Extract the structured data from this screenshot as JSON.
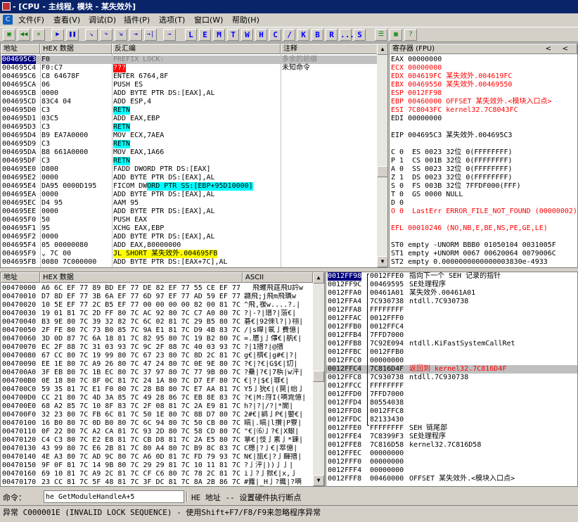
{
  "window": {
    "title": "- [CPU - 主线程, 模块 - 某失效外]"
  },
  "menu": [
    {
      "label": "文件(F)",
      "name": "menu-file"
    },
    {
      "label": "查看(V)",
      "name": "menu-view"
    },
    {
      "label": "调试(D)",
      "name": "menu-debug"
    },
    {
      "label": "插件(P)",
      "name": "menu-plugins"
    },
    {
      "label": "选项(T)",
      "name": "menu-options"
    },
    {
      "label": "窗口(W)",
      "name": "menu-window"
    },
    {
      "label": "帮助(H)",
      "name": "menu-help"
    }
  ],
  "toolbar": {
    "buttons": [
      {
        "icon": "open-icon",
        "glyph": "▣"
      },
      {
        "icon": "rewind-icon",
        "glyph": "◀◀"
      },
      {
        "icon": "close-icon",
        "glyph": "✕"
      },
      {
        "icon": "run-icon",
        "glyph": "▶"
      },
      {
        "icon": "pause-icon",
        "glyph": "❚❚"
      },
      {
        "icon": "step-into-icon",
        "glyph": "↘"
      },
      {
        "icon": "step-over-icon",
        "glyph": "↷"
      },
      {
        "icon": "trace-into-icon",
        "glyph": "⇲"
      },
      {
        "icon": "trace-over-icon",
        "glyph": "⇥"
      },
      {
        "icon": "execute-till-return-icon",
        "glyph": "→|"
      },
      {
        "icon": "goto-icon",
        "glyph": "→"
      }
    ],
    "letters": [
      "L",
      "E",
      "M",
      "T",
      "W",
      "H",
      "C",
      "/",
      "K",
      "B",
      "R",
      "...",
      "S"
    ],
    "extra": [
      {
        "icon": "list-icon",
        "glyph": "☰"
      },
      {
        "icon": "grid-icon",
        "glyph": "▦"
      },
      {
        "icon": "help-icon",
        "glyph": "?"
      }
    ]
  },
  "disasm": {
    "headers": [
      "地址",
      "HEX 数据",
      "反汇编",
      "注释"
    ],
    "rows": [
      {
        "addr": "004695C3",
        "hex": "F0",
        "asm": "PREFIX LOCK:",
        "cmt": "多余的前缀",
        "state": "selected"
      },
      {
        "addr": "004695C4",
        "hex": "F0:C7",
        "asm": "???",
        "cmt": "未知命令",
        "asm_style": "red"
      },
      {
        "addr": "004695C6",
        "hex": "C8 64678F",
        "asm": "ENTER 6764,8F",
        "cmt": ""
      },
      {
        "addr": "004695CA",
        "hex": "06",
        "asm": "PUSH ES",
        "cmt": ""
      },
      {
        "addr": "004695CB",
        "hex": "0000",
        "asm": "ADD BYTE PTR DS:[EAX],AL",
        "cmt": ""
      },
      {
        "addr": "004695CD",
        "hex": "83C4 04",
        "asm": "ADD ESP,4",
        "cmt": ""
      },
      {
        "addr": "004695D0",
        "hex": "C3",
        "asm": "RETN",
        "cmt": "",
        "asm_style": "cyan"
      },
      {
        "addr": "004695D1",
        "hex": "03C5",
        "asm": "ADD EAX,EBP",
        "cmt": ""
      },
      {
        "addr": "004695D3",
        "hex": "C3",
        "asm": "RETN",
        "cmt": "",
        "asm_style": "cyan"
      },
      {
        "addr": "004695D4",
        "hex": "B9 EA7A0000",
        "asm": "MOV ECX,7AEA",
        "cmt": ""
      },
      {
        "addr": "004695D9",
        "hex": "C3",
        "asm": "RETN",
        "cmt": "",
        "asm_style": "cyan"
      },
      {
        "addr": "004695DA",
        "hex": "B8 661A0000",
        "asm": "MOV EAX,1A66",
        "cmt": ""
      },
      {
        "addr": "004695DF",
        "hex": "C3",
        "asm": "RETN",
        "cmt": "",
        "asm_style": "cyan"
      },
      {
        "addr": "004695E0",
        "hex": "D800",
        "asm": "FADD DWORD PTR DS:[EAX]",
        "cmt": ""
      },
      {
        "addr": "004695E2",
        "hex": "0000",
        "asm": "ADD BYTE PTR DS:[EAX],AL",
        "cmt": ""
      },
      {
        "addr": "004695E4",
        "hex": "DA95 0000D195",
        "asm": "FICOM DWORD PTR SS:[EBP+95D10000]",
        "cmt": "",
        "asm_style": "cyanpart"
      },
      {
        "addr": "004695EA",
        "hex": "0000",
        "asm": "ADD BYTE PTR DS:[EAX],AL",
        "cmt": ""
      },
      {
        "addr": "004695EC",
        "hex": "D4 95",
        "asm": "AAM 95",
        "cmt": ""
      },
      {
        "addr": "004695EE",
        "hex": "0000",
        "asm": "ADD BYTE PTR DS:[EAX],AL",
        "cmt": ""
      },
      {
        "addr": "004695F0",
        "hex": "50",
        "asm": "PUSH EAX",
        "cmt": ""
      },
      {
        "addr": "004695F1",
        "hex": "95",
        "asm": "XCHG EAX,EBP",
        "cmt": ""
      },
      {
        "addr": "004695F2",
        "hex": "0000",
        "asm": "ADD BYTE PTR DS:[EAX],AL",
        "cmt": ""
      },
      {
        "addr": "004695F4",
        "hex": "05 00000080",
        "asm": "ADD EAX,80000000",
        "cmt": ""
      },
      {
        "addr": "004695F9",
        "hex": "⌄ 7C 00",
        "asm": "JL SHORT 某失效外.004695FB",
        "cmt": "",
        "asm_style": "yellow"
      },
      {
        "addr": "004695FB",
        "hex": "0080 7C000000",
        "asm": "ADD BYTE PTR DS:[EAX+7C],AL",
        "cmt": ""
      }
    ]
  },
  "registers": {
    "header": "寄存器 (FPU)",
    "nav": [
      "<",
      "<"
    ],
    "lines": [
      {
        "t": "EAX 00000000"
      },
      {
        "t": "ECX 00000000",
        "r": true
      },
      {
        "t": "EDX 004619FC 某失效外.004619FC",
        "r": true
      },
      {
        "t": "EBX 00469550 某失效外.00469550",
        "r": true
      },
      {
        "t": "ESP 0012FF98",
        "r": true
      },
      {
        "t": "EBP 00460000 OFFSET 某失效外.<模块入口点>",
        "r": true
      },
      {
        "t": "ESI 7C8043FC kernel32.7C8043FC",
        "r": true
      },
      {
        "t": "EDI 00000000"
      },
      {
        "t": ""
      },
      {
        "t": "EIP 004695C3 某失效外.004695C3"
      },
      {
        "t": ""
      },
      {
        "t": "C 0  ES 0023 32位 0(FFFFFFFF)"
      },
      {
        "t": "P 1  CS 001B 32位 0(FFFFFFFF)"
      },
      {
        "t": "A 0  SS 0023 32位 0(FFFFFFFF)"
      },
      {
        "t": "Z 1  DS 0023 32位 0(FFFFFFFF)"
      },
      {
        "t": "S 0  FS 003B 32位 7FFDF000(FFF)"
      },
      {
        "t": "T 0  GS 0000 NULL"
      },
      {
        "t": "D 0"
      },
      {
        "t": "O 0  LastErr ERROR_FILE_NOT_FOUND (00000002)",
        "r": true
      },
      {
        "t": ""
      },
      {
        "t": "EFL 00010246 (NO,NB,E,BE,NS,PE,GE,LE)"
      },
      {
        "t": ""
      },
      {
        "t": "ST0 empty -UNORM BBB0 01050104 0031005F"
      },
      {
        "t": "ST1 empty +UNORM 0067 00620064 0079006C"
      },
      {
        "t": "ST2 empty 0.0000000000000003830e-4933"
      },
      {
        "t": "ST3 empty 0.0"
      },
      {
        "t": "ST4 empty 0.0"
      }
    ]
  },
  "dump": {
    "headers": [
      "地址",
      "HEX 数据",
      "ASCII"
    ],
    "rows": [
      {
        "a": "00470000",
        "h": "A6 6C EF 77 89 BD EF 77 DE 82 EF 77 55 CE EF 77",
        "s": "  飛蠼飛莛飛U訡w"
      },
      {
        "a": "00470010",
        "h": "D7 8D EF 77 3B 6A EF 77 6D 97 EF 77 AD 59 EF 77",
        "s": "讔飛;j飛m飛璝w"
      },
      {
        "a": "00470020",
        "h": "10 5E EF 77 2C B5 EF 77 00 00 00 00 82 00 81 7C",
        "s": "^飛,禐w....?.|"
      },
      {
        "a": "00470030",
        "h": "19 01 81 7C 2D FF 80 7C AC 92 80 7C C7 A0 80 7C",
        "s": "?|-?|瑨?|菭€|"
      },
      {
        "a": "00470040",
        "h": "B3 9E 80 7C 39 32 82 7C 6C 02 81 7C 29 B5 80 7C",
        "s": "碁€|92倈l?|)祤|"
      },
      {
        "a": "00470050",
        "h": "2F FE 80 7C 73 B0 85 7C 9A E1 81 7C D9 4B 83 7C",
        "s": "/|s皡|氠亅費億|"
      },
      {
        "a": "00470060",
        "h": "3D 0D 87 7C 6A 18 81 7C 82 95 80 7C 19 B2 80 7C",
        "s": "=.噟j亅倳€|舧€|"
      },
      {
        "a": "00470070",
        "h": "EC 2F 88 7C 31 03 93 7C 9C 2F 88 7C 40 03 93 7C",
        "s": "?|1搢?|@搢"
      },
      {
        "a": "00470080",
        "h": "67 CC 80 7C 19 99 80 7C 67 23 80 7C 8D 2C 81 7C",
        "s": "g€|櫅€|g#€|?|"
      },
      {
        "a": "00470090",
        "h": "EE 1E 80 7C A9 26 80 7C 47 24 80 7C 0E 9E 80 7C",
        "s": "?€|?€|G$€|灱|"
      },
      {
        "a": "004700A0",
        "h": "3F EB 80 7C 1B EC 80 7C 37 97 80 7C 77 9B 80 7C",
        "s": "?雧|?€|7梹|w泙|"
      },
      {
        "a": "004700B0",
        "h": "0E 18 80 7C 8F 0C 81 7C 24 1A 80 7C D7 EF 80 7C",
        "s": "€|?|$€|罪€|"
      },
      {
        "a": "004700C0",
        "h": "59 35 81 7C E1 F0 80 7C 28 B8 80 7C E7 AA 81 7C",
        "s": "Y5亅狁€|(笢|绐亅"
      },
      {
        "a": "004700D0",
        "h": "CC 21 80 7C 4D 3A 85 7C 49 28 86 7C EB 8E 83 7C",
        "s": "?€|M:厊I(唡雿億|"
      },
      {
        "a": "004700E0",
        "h": "68 A2 85 7C 10 8F 83 7C 2F 08 81 7C 2A E9 81 7C",
        "s": "h?|?|/?|*閬|"
      },
      {
        "a": "004700F0",
        "h": "32 23 80 7C FB 6C 81 7C 50 1E 80 7C 8B D7 80 7C",
        "s": "2#€|鹟亅P€|嬜€|"
      },
      {
        "a": "00470100",
        "h": "16 B0 80 7C 0D B0 80 7C 6C 94 80 7C 50 CB 80 7C",
        "s": "皜|.皜|l攢|P藔|"
      },
      {
        "a": "00470110",
        "h": "0F 22 80 7C A2 CA 81 7C 93 2D 80 7C 58 CD 80 7C",
        "s": "\"€|⑹亅?€|X蛝|"
      },
      {
        "a": "00470120",
        "h": "C4 C3 80 7C E2 E8 81 7C CB D8 81 7C 2A E5 80 7C",
        "s": "拿€|忮亅素亅*鍊|"
      },
      {
        "a": "00470130",
        "h": "43 99 80 7C E6 2B 81 7C 80 A4 80 7C B9 8C 83 7C",
        "s": "C檧|?亅€|箤億|"
      },
      {
        "a": "00470140",
        "h": "4E A3 80 7C AD 9C 80 7C A6 0D 81 7C FD 79 93 7C",
        "s": "N€|瓬€|?亅齳搢|"
      },
      {
        "a": "00470150",
        "h": "9F 0F 81 7C 14 9B 80 7C 29 29 81 7C 10 11 81 7C",
        "s": "?亅泙|))亅亅|"
      },
      {
        "a": "00470160",
        "h": "69 10 81 7C A9 2C 81 7C CF C6 80 7C 78 2C 81 7C",
        "s": "i亅?亅掀€|x,亅"
      },
      {
        "a": "00470170",
        "h": "23 CC 81 7C 5F 48 81 7C 3F DC 81 7C 8A 2B 86 7C",
        "s": "#虂|_H亅?軄|?唡"
      }
    ]
  },
  "stack": {
    "rows": [
      {
        "a": "0012FF98",
        "v": "0012FFE0",
        "c": "指向下一个 SEH 记录的指针",
        "sel": true
      },
      {
        "a": "0012FF9C",
        "v": "00469595",
        "c": "SE处理程序"
      },
      {
        "a": "0012FFA0",
        "v": "00461A01",
        "c": "某失效外.00461A01"
      },
      {
        "a": "0012FFA4",
        "v": "7C930738",
        "c": "ntdll.7C930738"
      },
      {
        "a": "0012FFA8",
        "v": "FFFFFFFF",
        "c": ""
      },
      {
        "a": "0012FFAC",
        "v": "0012FFF0",
        "c": ""
      },
      {
        "a": "0012FFB0",
        "v": "0012FFC4",
        "c": ""
      },
      {
        "a": "0012FFB4",
        "v": "7FFD7000",
        "c": ""
      },
      {
        "a": "0012FFB8",
        "v": "7C92E094",
        "c": "ntdll.KiFastSystemCallRet"
      },
      {
        "a": "0012FFBC",
        "v": "0012FFB0",
        "c": ""
      },
      {
        "a": "0012FFC0",
        "v": "00000000",
        "c": ""
      },
      {
        "a": "0012FFC4",
        "v": "7C816D4F",
        "c": "返回到 kernel32.7C816D4F",
        "hl": true
      },
      {
        "a": "0012FFC8",
        "v": "7C930738",
        "c": "ntdll.7C930738"
      },
      {
        "a": "0012FFCC",
        "v": "FFFFFFFF",
        "c": ""
      },
      {
        "a": "0012FFD0",
        "v": "7FFD7000",
        "c": ""
      },
      {
        "a": "0012FFD4",
        "v": "80554038",
        "c": ""
      },
      {
        "a": "0012FFD8",
        "v": "0012FFC8",
        "c": ""
      },
      {
        "a": "0012FFDC",
        "v": "82133430",
        "c": ""
      },
      {
        "a": "0012FFE0",
        "v": "FFFFFFFF",
        "c": "SEH 链尾部"
      },
      {
        "a": "0012FFE4",
        "v": "7C8399F3",
        "c": "SE处理程序"
      },
      {
        "a": "0012FFE8",
        "v": "7C816D58",
        "c": "kernel32.7C816D58"
      },
      {
        "a": "0012FFEC",
        "v": "00000000",
        "c": ""
      },
      {
        "a": "0012FFF0",
        "v": "00000000",
        "c": ""
      },
      {
        "a": "0012FFF4",
        "v": "00000000",
        "c": ""
      },
      {
        "a": "0012FFF8",
        "v": "00460000",
        "c": "OFFSET 某失效外.<模块入口点>"
      }
    ]
  },
  "command": {
    "label": "命令：",
    "value": "he GetModuleHandleA+5",
    "hint": "HE 地址 -- 设置硬件执行断点"
  },
  "status": {
    "text": "异常 C000001E (INVALID LOCK SEQUENCE) - 使用Shift+F7/F8/F9来忽略程序异常"
  }
}
